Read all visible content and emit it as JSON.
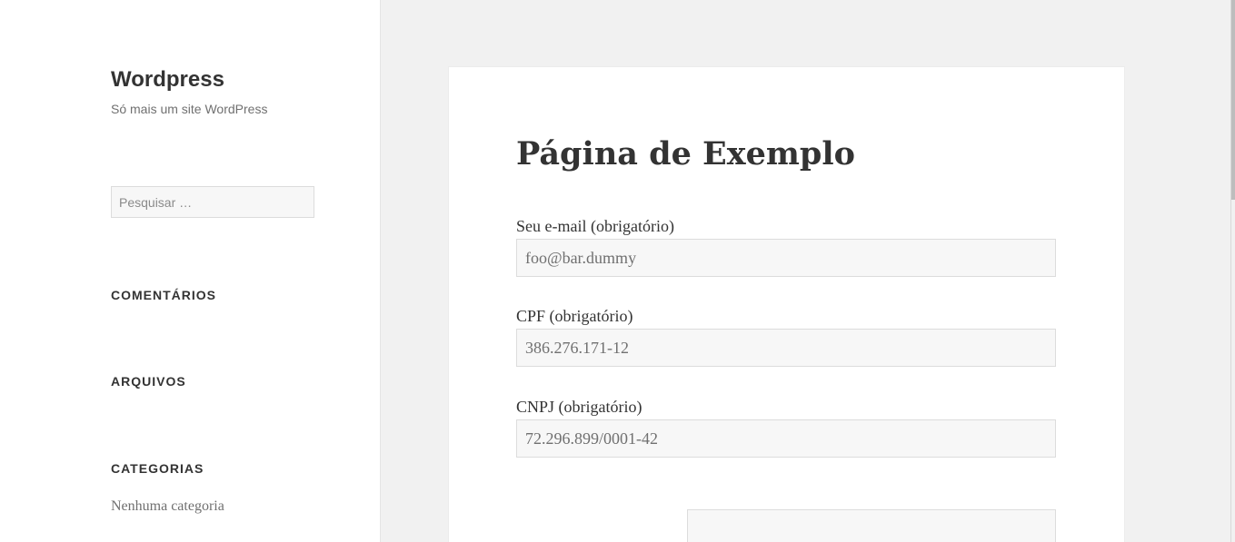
{
  "site": {
    "title": "Wordpress",
    "description": "Só mais um site WordPress"
  },
  "search": {
    "placeholder": "Pesquisar …"
  },
  "widgets": {
    "comments_title": "COMENTÁRIOS",
    "archives_title": "ARQUIVOS",
    "categories_title": "CATEGORIAS",
    "categories_items": [
      "Nenhuma categoria"
    ]
  },
  "page": {
    "title": "Página de Exemplo",
    "fields": [
      {
        "label": "Seu e-mail (obrigatório)",
        "value": "foo@bar.dummy"
      },
      {
        "label": "CPF (obrigatório)",
        "value": "386.276.171-12"
      },
      {
        "label": "CNPJ (obrigatório)",
        "value": "72.296.899/0001-42"
      }
    ]
  },
  "colors": {
    "background": "#f1f1f1",
    "panel": "#ffffff",
    "input_background": "#f7f7f7",
    "text": "#333333",
    "muted_text": "#707070"
  }
}
